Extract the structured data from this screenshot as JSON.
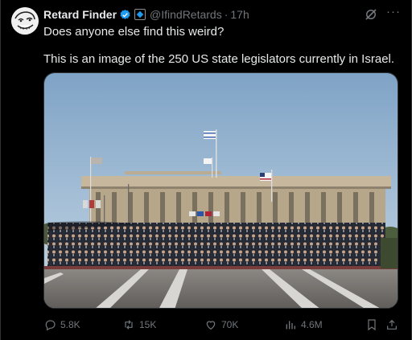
{
  "post": {
    "author_name": "Retard Finder",
    "handle": "@IfindRetards",
    "separator": "·",
    "time": "17h",
    "line1": "Does anyone else find this weird?",
    "line2": "This is an image of the 250 US state legislators currently in Israel.",
    "more_label": "···"
  },
  "actions": {
    "replies": "5.8K",
    "reposts": "15K",
    "likes": "70K",
    "views": "4.6M"
  },
  "colors": {
    "background": "#000000",
    "text": "#e7e9ea",
    "muted": "#71767b",
    "verified": "#1d9bf0",
    "border": "#2f3336"
  },
  "icons": [
    "avatar-meme-face",
    "verified-badge-icon",
    "affiliation-badge-icon",
    "grok-icon",
    "more-icon",
    "reply-icon",
    "repost-icon",
    "like-icon",
    "views-icon",
    "bookmark-icon",
    "share-icon"
  ]
}
